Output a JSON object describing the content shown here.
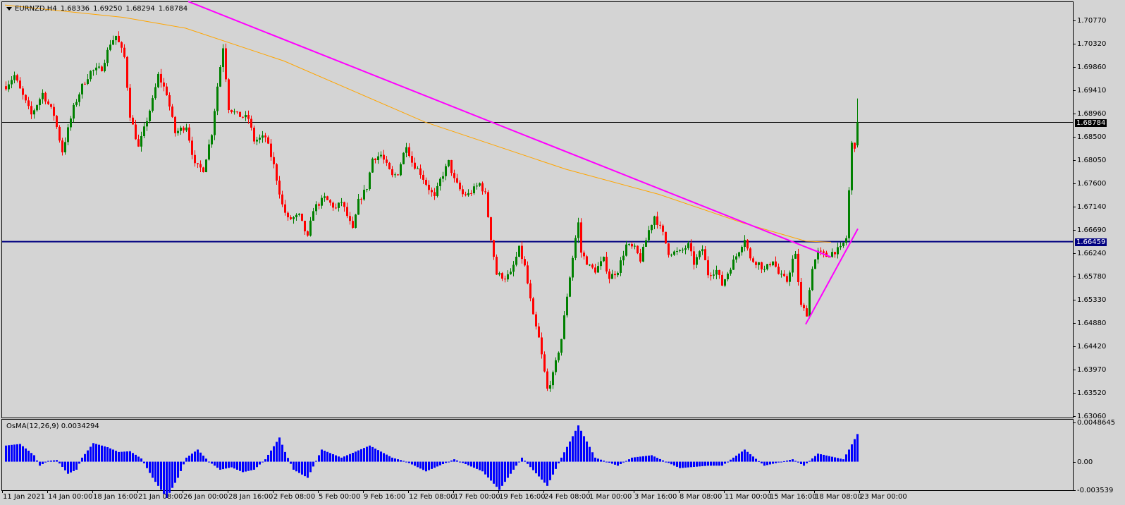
{
  "header": {
    "symbol": "EURNZD,H4",
    "open": "1.68336",
    "high": "1.69250",
    "low": "1.68294",
    "close": "1.68784"
  },
  "indicator": {
    "label": "OsMA(12,26,9) 0.0034294"
  },
  "colors": {
    "up": "#008000",
    "down": "#ff0000",
    "ma": "#ffa500",
    "trendline": "#ff00ff",
    "support": "#000080",
    "bid": "#000000",
    "osma": "#0000ff",
    "background": "#d4d4d4"
  },
  "price_axis": [
    "1.70770",
    "1.70320",
    "1.69860",
    "1.69410",
    "1.68960",
    "1.68500",
    "1.68050",
    "1.67600",
    "1.67140",
    "1.66690",
    "1.66240",
    "1.65780",
    "1.65330",
    "1.64880",
    "1.64420",
    "1.63970",
    "1.63520",
    "1.63060"
  ],
  "price_badges": {
    "bid": "1.68784",
    "level": "1.66459"
  },
  "indicator_axis": [
    "0.0048645",
    "0.00",
    "-0.003539"
  ],
  "time_axis": [
    "11 Jan 2021",
    "14 Jan 00:00",
    "18 Jan 16:00",
    "21 Jan 08:00",
    "26 Jan 00:00",
    "28 Jan 16:00",
    "2 Feb 08:00",
    "5 Feb 00:00",
    "9 Feb 16:00",
    "12 Feb 08:00",
    "17 Feb 00:00",
    "19 Feb 16:00",
    "24 Feb 08:00",
    "1 Mar 00:00",
    "3 Mar 16:00",
    "8 Mar 08:00",
    "11 Mar 00:00",
    "15 Mar 16:00",
    "18 Mar 08:00",
    "23 Mar 00:00"
  ],
  "chart_data": {
    "type": "candlestick",
    "title": "EURNZD,H4",
    "ylim": [
      1.6306,
      1.7077
    ],
    "bars": 303,
    "bars_per_time_label": 16,
    "close_path": [
      [
        0,
        1.6949
      ],
      [
        3,
        1.697
      ],
      [
        5,
        1.6942
      ],
      [
        9,
        1.6893
      ],
      [
        13,
        1.6935
      ],
      [
        17,
        1.6893
      ],
      [
        20,
        1.6822
      ],
      [
        24,
        1.6907
      ],
      [
        27,
        1.6949
      ],
      [
        30,
        1.6977
      ],
      [
        34,
        1.6984
      ],
      [
        37,
        1.7033
      ],
      [
        39,
        1.7047
      ],
      [
        42,
        1.7005
      ],
      [
        44,
        1.6893
      ],
      [
        47,
        1.6829
      ],
      [
        49,
        1.6865
      ],
      [
        52,
        1.6921
      ],
      [
        54,
        1.697
      ],
      [
        57,
        1.6935
      ],
      [
        60,
        1.6858
      ],
      [
        64,
        1.6872
      ],
      [
        67,
        1.6794
      ],
      [
        70,
        1.6787
      ],
      [
        73,
        1.6858
      ],
      [
        75,
        1.6949
      ],
      [
        77,
        1.7026
      ],
      [
        79,
        1.6907
      ],
      [
        82,
        1.6893
      ],
      [
        86,
        1.6886
      ],
      [
        88,
        1.6843
      ],
      [
        92,
        1.685
      ],
      [
        95,
        1.6794
      ],
      [
        98,
        1.6717
      ],
      [
        100,
        1.6689
      ],
      [
        104,
        1.6696
      ],
      [
        107,
        1.6653
      ],
      [
        109,
        1.671
      ],
      [
        113,
        1.6731
      ],
      [
        117,
        1.671
      ],
      [
        119,
        1.6724
      ],
      [
        123,
        1.6668
      ],
      [
        125,
        1.6724
      ],
      [
        128,
        1.6752
      ],
      [
        130,
        1.6808
      ],
      [
        133,
        1.6815
      ],
      [
        137,
        1.6773
      ],
      [
        139,
        1.678
      ],
      [
        142,
        1.6836
      ],
      [
        144,
        1.6801
      ],
      [
        147,
        1.678
      ],
      [
        149,
        1.6759
      ],
      [
        152,
        1.6731
      ],
      [
        154,
        1.6766
      ],
      [
        157,
        1.6801
      ],
      [
        159,
        1.6766
      ],
      [
        162,
        1.6738
      ],
      [
        164,
        1.6738
      ],
      [
        168,
        1.6759
      ],
      [
        170,
        1.6738
      ],
      [
        172,
        1.6653
      ],
      [
        174,
        1.6583
      ],
      [
        177,
        1.6576
      ],
      [
        179,
        1.6583
      ],
      [
        182,
        1.6632
      ],
      [
        184,
        1.6597
      ],
      [
        187,
        1.6499
      ],
      [
        189,
        1.6457
      ],
      [
        192,
        1.6358
      ],
      [
        194,
        1.6386
      ],
      [
        197,
        1.6457
      ],
      [
        199,
        1.6541
      ],
      [
        202,
        1.6653
      ],
      [
        203,
        1.6682
      ],
      [
        204,
        1.6625
      ],
      [
        207,
        1.6597
      ],
      [
        209,
        1.659
      ],
      [
        212,
        1.6611
      ],
      [
        214,
        1.6576
      ],
      [
        217,
        1.659
      ],
      [
        220,
        1.6639
      ],
      [
        223,
        1.6632
      ],
      [
        225,
        1.6611
      ],
      [
        228,
        1.6668
      ],
      [
        230,
        1.6696
      ],
      [
        233,
        1.6661
      ],
      [
        235,
        1.6625
      ],
      [
        239,
        1.6625
      ],
      [
        242,
        1.6639
      ],
      [
        244,
        1.6604
      ],
      [
        247,
        1.6632
      ],
      [
        249,
        1.6583
      ],
      [
        252,
        1.659
      ],
      [
        254,
        1.6562
      ],
      [
        257,
        1.6597
      ],
      [
        259,
        1.6618
      ],
      [
        262,
        1.6653
      ],
      [
        264,
        1.6611
      ],
      [
        267,
        1.6604
      ],
      [
        269,
        1.659
      ],
      [
        272,
        1.6611
      ],
      [
        274,
        1.6583
      ],
      [
        277,
        1.6569
      ],
      [
        279,
        1.6611
      ],
      [
        280,
        1.6618
      ],
      [
        282,
        1.652
      ],
      [
        284,
        1.6506
      ],
      [
        286,
        1.6597
      ],
      [
        288,
        1.6625
      ],
      [
        291,
        1.6618
      ],
      [
        293,
        1.6625
      ],
      [
        296,
        1.6632
      ],
      [
        298,
        1.6653
      ],
      [
        299,
        1.6745
      ],
      [
        300,
        1.6836
      ],
      [
        301,
        1.6833
      ],
      [
        302,
        1.68784
      ]
    ],
    "last_candle": {
      "open": 1.68336,
      "high": 1.6925,
      "low": 1.68294,
      "close": 1.68784
    },
    "moving_average": [
      [
        0,
        1.7107
      ],
      [
        42,
        1.7083
      ],
      [
        64,
        1.7062
      ],
      [
        99,
        1.6998
      ],
      [
        149,
        1.6879
      ],
      [
        199,
        1.6787
      ],
      [
        232,
        1.6738
      ],
      [
        262,
        1.6682
      ],
      [
        284,
        1.6647
      ],
      [
        293,
        1.6645
      ]
    ],
    "trendline": [
      [
        65,
        1.7114
      ],
      [
        293,
        1.6616
      ]
    ],
    "support_trendline": [
      [
        284,
        1.6485
      ],
      [
        302.5,
        1.6671
      ]
    ],
    "horizontal_levels": {
      "bid": 1.68784,
      "level": 1.66459
    },
    "osma": {
      "ylim": [
        -0.003539,
        0.0048645
      ],
      "path": [
        [
          0,
          0.002
        ],
        [
          5,
          0.0022
        ],
        [
          10,
          0.0008
        ],
        [
          12,
          -0.0005
        ],
        [
          15,
          0.0001
        ],
        [
          18,
          0.0002
        ],
        [
          22,
          -0.0015
        ],
        [
          25,
          -0.001
        ],
        [
          27,
          0.0005
        ],
        [
          31,
          0.0023
        ],
        [
          36,
          0.0018
        ],
        [
          40,
          0.0012
        ],
        [
          44,
          0.0013
        ],
        [
          48,
          0.0004
        ],
        [
          52,
          -0.002
        ],
        [
          57,
          -0.0045
        ],
        [
          61,
          -0.002
        ],
        [
          64,
          0.0005
        ],
        [
          68,
          0.0015
        ],
        [
          72,
          0.0
        ],
        [
          76,
          -0.001
        ],
        [
          80,
          -0.0007
        ],
        [
          84,
          -0.0013
        ],
        [
          88,
          -0.001
        ],
        [
          92,
          0.0003
        ],
        [
          97,
          0.003
        ],
        [
          99,
          0.0012
        ],
        [
          102,
          -0.001
        ],
        [
          107,
          -0.002
        ],
        [
          112,
          0.0015
        ],
        [
          119,
          0.0005
        ],
        [
          129,
          0.002
        ],
        [
          137,
          0.0005
        ],
        [
          142,
          0.0
        ],
        [
          149,
          -0.0012
        ],
        [
          159,
          0.0003
        ],
        [
          169,
          -0.0012
        ],
        [
          175,
          -0.0035
        ],
        [
          183,
          0.0005
        ],
        [
          192,
          -0.003
        ],
        [
          197,
          0.0005
        ],
        [
          203,
          0.0045
        ],
        [
          209,
          0.0005
        ],
        [
          217,
          -0.0005
        ],
        [
          222,
          0.0005
        ],
        [
          229,
          0.0008
        ],
        [
          239,
          -0.0008
        ],
        [
          249,
          -0.0005
        ],
        [
          254,
          -0.0005
        ],
        [
          262,
          0.0015
        ],
        [
          269,
          -0.0005
        ],
        [
          279,
          0.0003
        ],
        [
          283,
          -0.0005
        ],
        [
          288,
          0.001
        ],
        [
          297,
          0.0003
        ],
        [
          299,
          0.0015
        ],
        [
          301,
          0.0028
        ],
        [
          302,
          0.0034294
        ]
      ]
    }
  }
}
